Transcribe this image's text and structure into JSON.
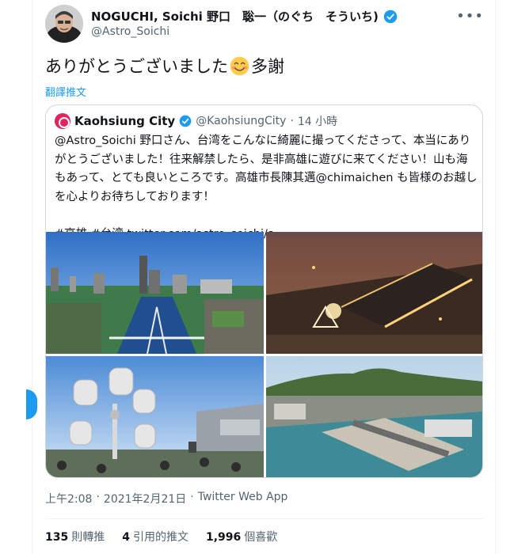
{
  "tweet": {
    "display_name": "NOGUCHI, Soichi 野口　聡一（のぐち　そういち)",
    "handle": "@Astro_Soichi",
    "more_icon": "more-dots-icon",
    "text": "ありがとうございました",
    "text_suffix": "多謝",
    "emoji": "smiling-face-emoji",
    "translate_label": "翻譯推文",
    "timestamp": "上午2:08",
    "date": "2021年2月21日",
    "source": "Twitter Web App",
    "dot": "·"
  },
  "quote": {
    "display_name": "Kaohsiung City",
    "handle": "@KaohsiungCity",
    "dot": "·",
    "time_ago": "14 小時",
    "lines": [
      "@Astro_Soichi 野口さん、台湾をこんなに綺麗に撮ってくださって、本当にあり",
      "がとうございました！往来解禁したら、是非高雄に遊びに来てください！山も海",
      "もあって、とても良いところです。高雄市長陳其邁@chimaichen も皆様のお越し",
      "を心よりお待ちしております！",
      "",
      "#高雄 #台湾  twitter.com/astro_soichi/s..."
    ],
    "photos": [
      "harbor-skyline-photo",
      "pier-night-aerial-photo",
      "ferris-wheel-photo",
      "mountain-harbor-aerial-photo"
    ]
  },
  "stats": {
    "retweets_count": "135",
    "retweets_label": "則轉推",
    "quotes_count": "4",
    "quotes_label": "引用的推文",
    "likes_count": "1,996",
    "likes_label": "個喜歡"
  },
  "colors": {
    "accent": "#1d9bf0",
    "muted": "#536471",
    "border": "#cfd9de",
    "brand_kaohsiung": "#e0245e"
  }
}
